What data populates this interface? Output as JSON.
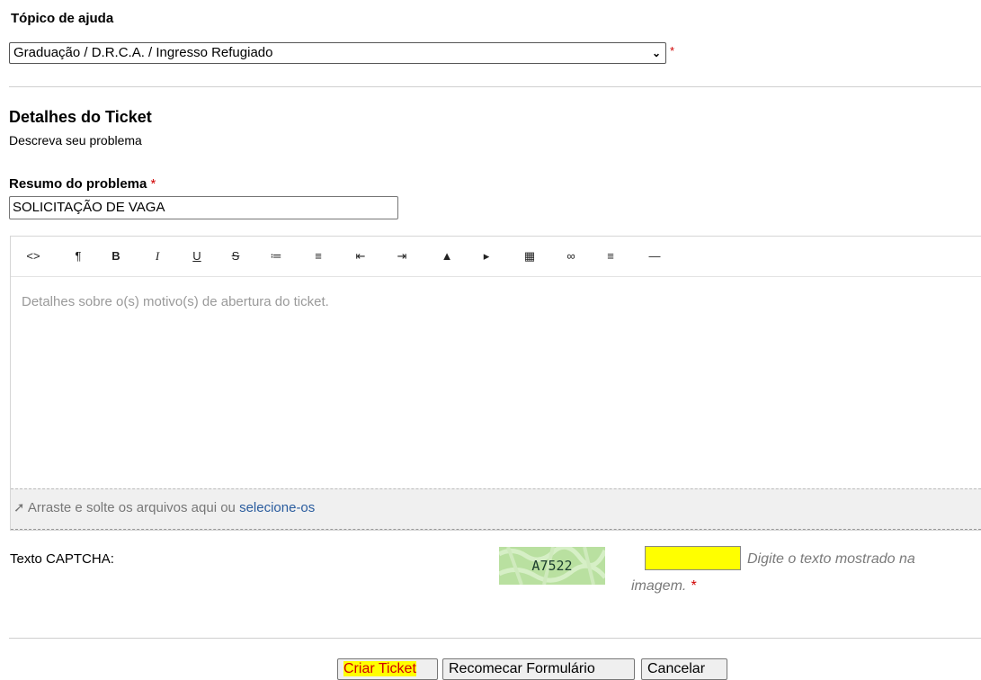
{
  "topic": {
    "label": "Tópico de ajuda",
    "selected": "Graduação / D.R.C.A. / Ingresso Refugiado",
    "required_mark": "*"
  },
  "details": {
    "title": "Detalhes do Ticket",
    "subtitle": "Descreva seu problema"
  },
  "summary": {
    "label": "Resumo do problema",
    "required_mark": "*",
    "value": "SOLICITAÇÃO DE VAGA"
  },
  "editor": {
    "toolbar": [
      {
        "name": "code-icon",
        "glyph": "<>"
      },
      {
        "name": "paragraph-icon",
        "glyph": "¶"
      },
      {
        "name": "bold-icon",
        "glyph": "B"
      },
      {
        "name": "italic-icon",
        "glyph": "I"
      },
      {
        "name": "underline-icon",
        "glyph": "U"
      },
      {
        "name": "strikethrough-icon",
        "glyph": "S"
      },
      {
        "name": "unordered-list-icon",
        "glyph": "≔"
      },
      {
        "name": "ordered-list-icon",
        "glyph": "≡"
      },
      {
        "name": "outdent-icon",
        "glyph": "⇤"
      },
      {
        "name": "indent-icon",
        "glyph": "⇥"
      },
      {
        "name": "image-icon",
        "glyph": "▲"
      },
      {
        "name": "video-icon",
        "glyph": "▸"
      },
      {
        "name": "table-icon",
        "glyph": "▦"
      },
      {
        "name": "link-icon",
        "glyph": "∞"
      },
      {
        "name": "align-icon",
        "glyph": "≡"
      },
      {
        "name": "horizontal-rule-icon",
        "glyph": "—"
      }
    ],
    "placeholder": "Detalhes sobre o(s) motivo(s) de abertura do ticket.",
    "dropzone_text": "Arraste e solte os arquivos aqui ou",
    "dropzone_link": "selecione-os"
  },
  "captcha": {
    "label": "Texto CAPTCHA:",
    "image_text": "A7522",
    "hint_line1": "Digite o texto mostrado na",
    "hint_line2": "imagem.",
    "required_mark": "*",
    "input_color": "#ffff00"
  },
  "buttons": {
    "create": "Criar Ticket",
    "reset": "Recomecar Formulário",
    "cancel": "Cancelar"
  }
}
